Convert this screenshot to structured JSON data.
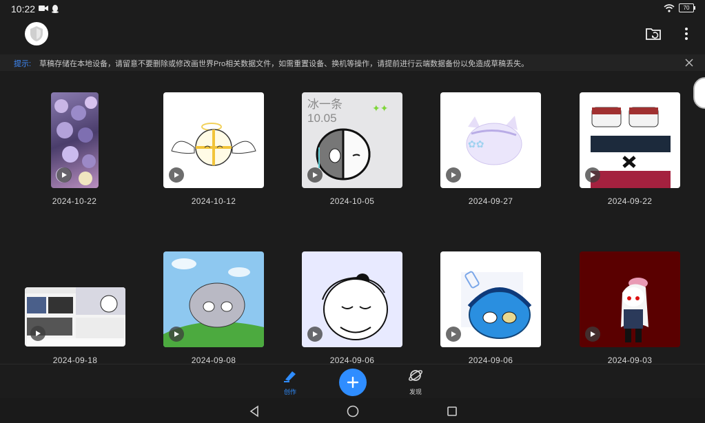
{
  "status_bar": {
    "time": "10:22",
    "battery": "70"
  },
  "tip": {
    "label": "提示:",
    "text": "草稿存储在本地设备，请留意不要删除或修改画世界Pro相关数据文件，如需重置设备、换机等操作，请提前进行云端数据备份以免造成草稿丢失。"
  },
  "drafts": [
    {
      "date": "2024-10-22",
      "thumb_bg": "#6a5a8a"
    },
    {
      "date": "2024-10-12",
      "thumb_bg": "#ffffff"
    },
    {
      "date": "2024-10-05",
      "thumb_bg": "#e6e6e8",
      "caption": "冰一条 10.05"
    },
    {
      "date": "2024-09-27",
      "thumb_bg": "#ffffff"
    },
    {
      "date": "2024-09-22",
      "thumb_bg": "#ffffff"
    },
    {
      "date": "2024-09-18",
      "thumb_bg": "#f4f4f4"
    },
    {
      "date": "2024-09-08",
      "thumb_bg": "#8ec8f0"
    },
    {
      "date": "2024-09-06",
      "thumb_bg": "#e8eaff"
    },
    {
      "date": "2024-09-06",
      "thumb_bg": "#ffffff"
    },
    {
      "date": "2024-09-03",
      "thumb_bg": "#5a0000"
    }
  ],
  "bottom_nav": {
    "create_label": "创作",
    "discover_label": "发现",
    "active_color": "#2f8dff"
  }
}
